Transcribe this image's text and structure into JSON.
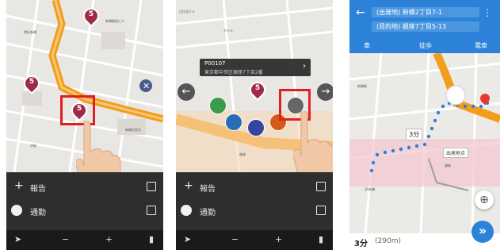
{
  "colors": {
    "accent_blue": "#2b82d8",
    "route_orange": "#f29d1c",
    "pin_red": "#9e2a45",
    "highlight_red": "#e02020",
    "route_dots": "#2b82d8"
  },
  "panel1": {
    "pins": [
      {
        "label": "5"
      },
      {
        "label": "5"
      },
      {
        "label": "5"
      }
    ],
    "sheet": {
      "row1": {
        "icon": "plus-icon",
        "label": "報告"
      },
      "row2": {
        "icon": "circle-icon",
        "label": "通勤"
      }
    },
    "bottom": {
      "nav": "➤",
      "minus": "−",
      "plus": "+",
      "menu": "▮"
    }
  },
  "panel2": {
    "popup": {
      "title": "P00107",
      "subtitle": "東京都中央区銀座7丁目2番"
    },
    "pins": [
      {
        "label": "5"
      }
    ],
    "sheet": {
      "row1": {
        "label": "報告"
      },
      "row2": {
        "label": "通勤"
      }
    },
    "bottom": {
      "nav": "➤",
      "minus": "−",
      "plus": "+",
      "menu": "▮"
    },
    "left_arrow": "←",
    "right_arrow": "→"
  },
  "panel3": {
    "topbar": {
      "back": "←",
      "from": "(出発地) 新橋2丁目7-1",
      "to": "(目的地) 銀座7丁目5-13",
      "more": "⋮",
      "modes": [
        "車",
        "徒歩",
        "電車"
      ]
    },
    "route_label": "3分",
    "map_label": "出発地点",
    "status": {
      "time": "3分",
      "distance": "(290m)"
    },
    "fab_go": "»",
    "locate": "⊕"
  }
}
